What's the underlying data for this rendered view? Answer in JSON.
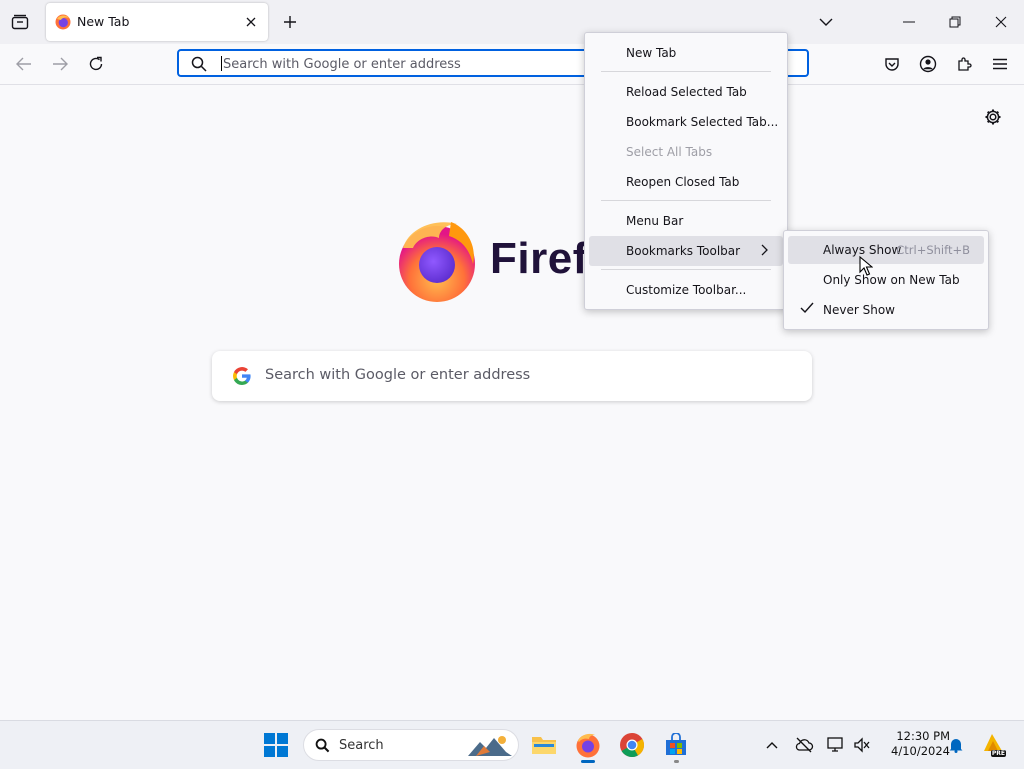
{
  "tab": {
    "title": "New Tab"
  },
  "urlbar": {
    "placeholder": "Search with Google or enter address"
  },
  "content": {
    "wordmark": "Firefox",
    "search_placeholder": "Search with Google or enter address"
  },
  "context_menu": {
    "items": [
      {
        "label": "New Tab"
      },
      {
        "label": "Reload Selected Tab"
      },
      {
        "label": "Bookmark Selected Tab..."
      },
      {
        "label": "Select All Tabs"
      },
      {
        "label": "Reopen Closed Tab"
      },
      {
        "label": "Menu Bar"
      },
      {
        "label": "Bookmarks Toolbar"
      },
      {
        "label": "Customize Toolbar..."
      }
    ]
  },
  "submenu": {
    "items": [
      {
        "label": "Always Show",
        "shortcut": "Ctrl+Shift+B"
      },
      {
        "label": "Only Show on New Tab"
      },
      {
        "label": "Never Show",
        "checked": true
      }
    ]
  },
  "taskbar": {
    "search_label": "Search",
    "time": "12:30 PM",
    "date": "4/10/2024",
    "badge": "PRE"
  },
  "colors": {
    "accent": "#0061e0",
    "tabstrip": "#f0f0f4",
    "menu_hover": "#e0e0e6"
  }
}
